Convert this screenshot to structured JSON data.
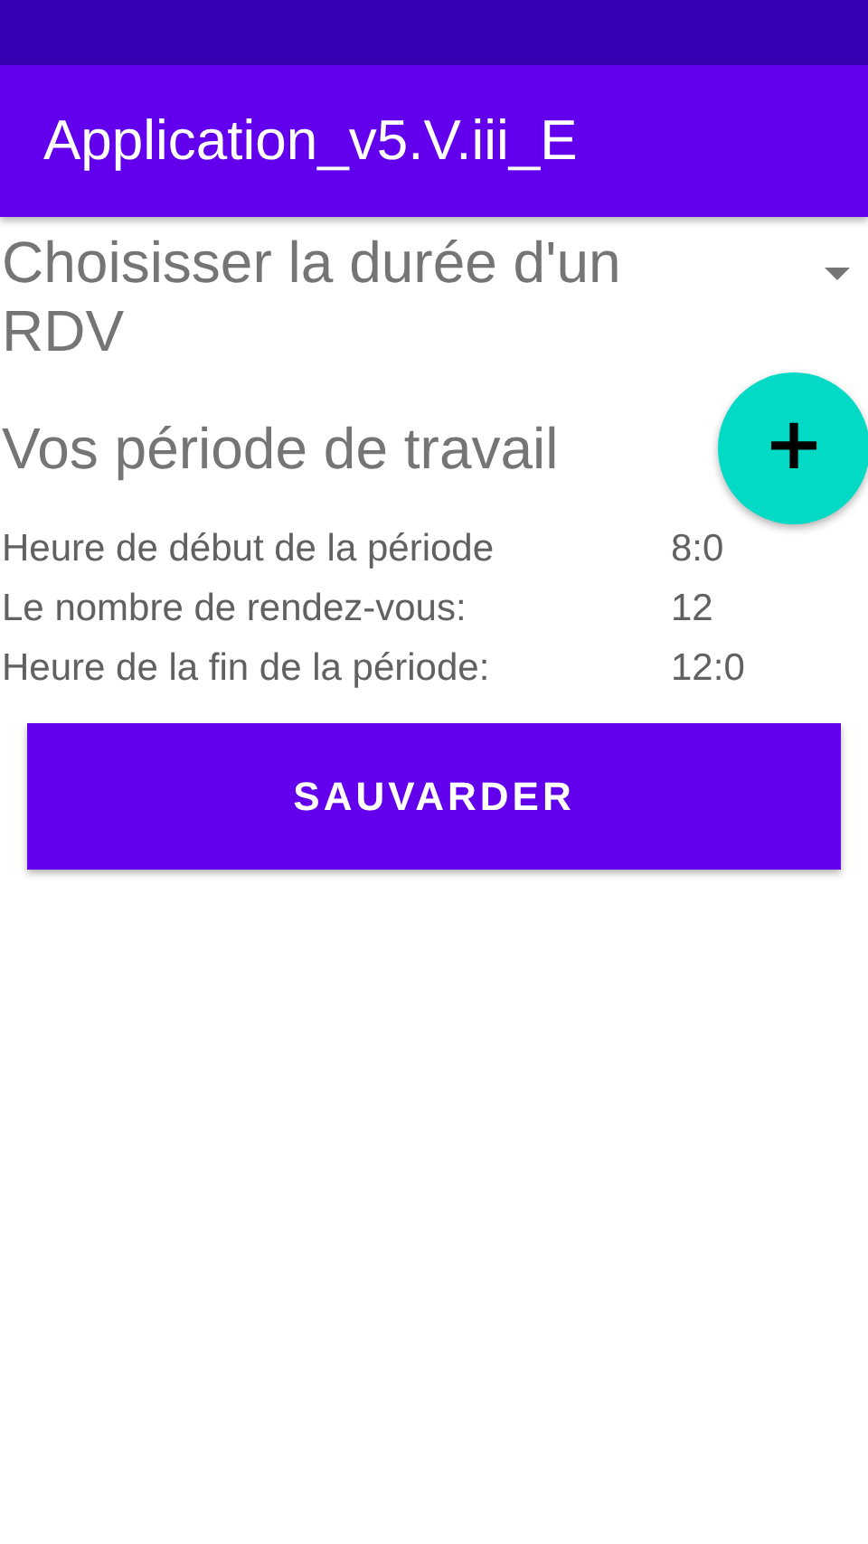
{
  "app_bar": {
    "title": "Application_v5.V.iii_E"
  },
  "spinner": {
    "value": "Choisisser la durée d'un RDV"
  },
  "section": {
    "title": "Vos période de travail"
  },
  "fab": {
    "label": "+"
  },
  "rows": [
    {
      "label": "Heure de début de la période",
      "value": "8:0"
    },
    {
      "label": "Le nombre de rendez-vous:",
      "value": "12"
    },
    {
      "label": "Heure de la fin de la période:",
      "value": "12:0"
    }
  ],
  "buttons": [
    {
      "label": "SAUVARDER"
    }
  ]
}
